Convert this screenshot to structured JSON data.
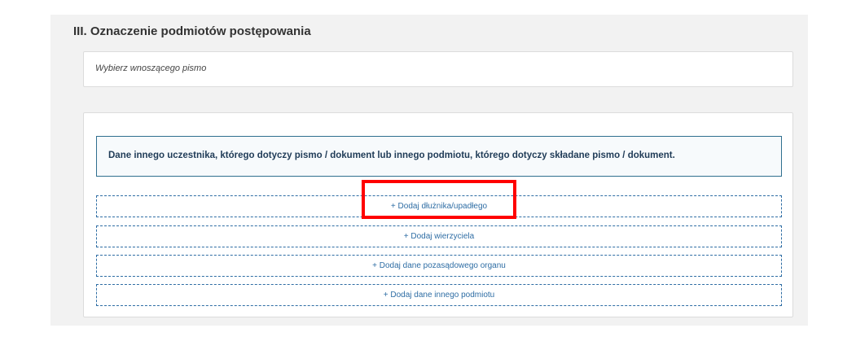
{
  "section": {
    "title": "III. Oznaczenie podmiotów postępowania"
  },
  "filer_select": {
    "placeholder": "Wybierz wnoszącego pismo"
  },
  "participants": {
    "info": "Dane innego uczestnika, którego dotyczy pismo / dokument lub innego podmiotu, którego dotyczy składane pismo / dokument.",
    "buttons": [
      {
        "label": "+ Dodaj dłużnika/upadłego"
      },
      {
        "label": "+ Dodaj wierzyciela"
      },
      {
        "label": "+ Dodaj dane pozasądowego organu"
      },
      {
        "label": "+ Dodaj dane innego podmiotu"
      }
    ]
  },
  "colors": {
    "accent": "#2e6da4",
    "highlight": "#ff0000",
    "panel_bg": "#f2f2f2"
  }
}
